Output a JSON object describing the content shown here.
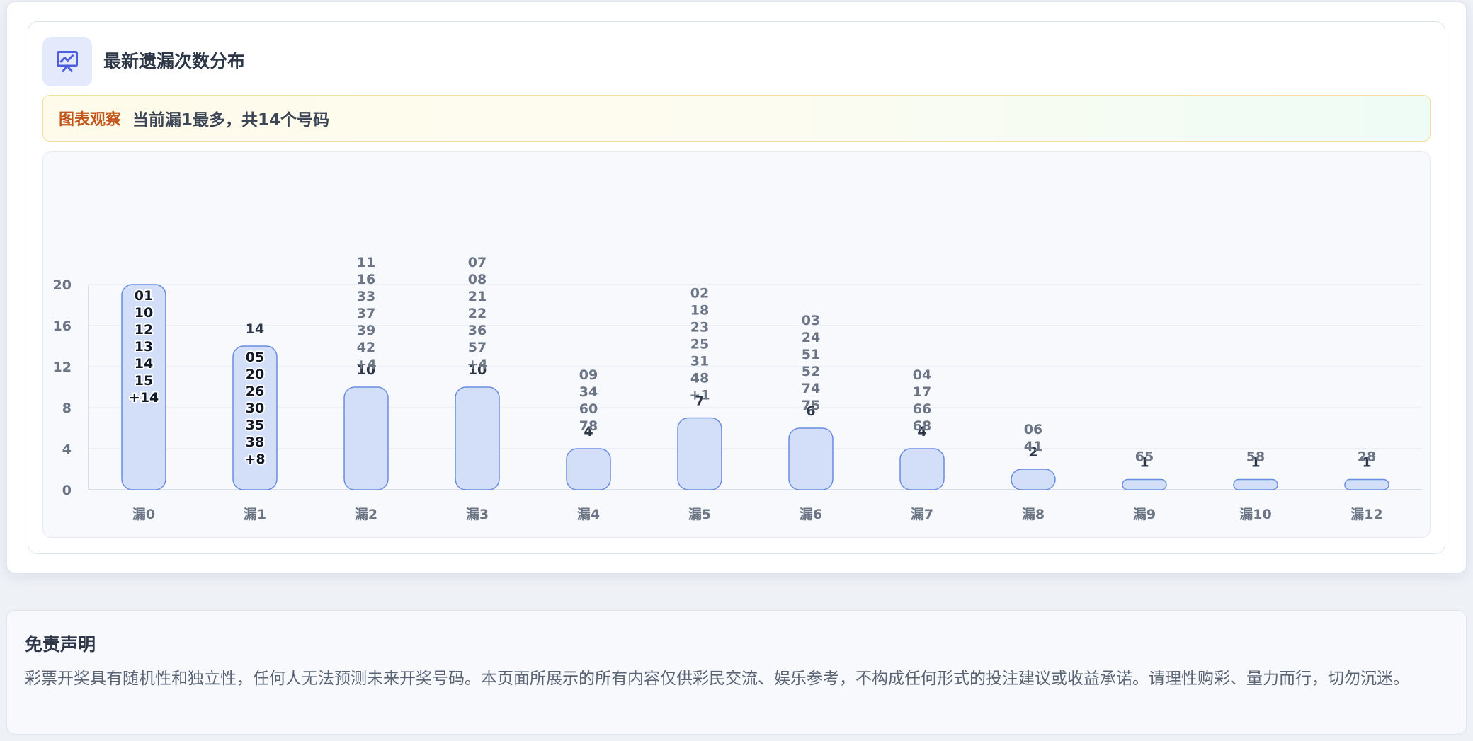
{
  "card": {
    "title": "最新遗漏次数分布",
    "icon": "presentation-chart-icon"
  },
  "insight": {
    "tag": "图表观察",
    "text": "当前漏1最多，共14个号码"
  },
  "colors": {
    "bar_fill": "#d3def8",
    "bar_stroke": "#6a8ce0",
    "accent": "#c0561b",
    "icon": "#4c5ee0"
  },
  "chart_data": {
    "type": "bar",
    "categories": [
      "漏0",
      "漏1",
      "漏2",
      "漏3",
      "漏4",
      "漏5",
      "漏6",
      "漏7",
      "漏8",
      "漏9",
      "漏10",
      "漏12"
    ],
    "values": [
      20,
      14,
      10,
      10,
      4,
      7,
      6,
      4,
      2,
      1,
      1,
      1
    ],
    "numbers": [
      [
        "01",
        "10",
        "12",
        "13",
        "14",
        "15",
        "+14"
      ],
      [
        "05",
        "20",
        "26",
        "30",
        "35",
        "38",
        "+8"
      ],
      [
        "11",
        "16",
        "33",
        "37",
        "39",
        "42",
        "+4"
      ],
      [
        "07",
        "08",
        "21",
        "22",
        "36",
        "57",
        "+4"
      ],
      [
        "09",
        "34",
        "60",
        "78"
      ],
      [
        "02",
        "18",
        "23",
        "25",
        "31",
        "48",
        "+1"
      ],
      [
        "03",
        "24",
        "51",
        "52",
        "74",
        "75"
      ],
      [
        "04",
        "17",
        "66",
        "68"
      ],
      [
        "06",
        "41"
      ],
      [
        "65"
      ],
      [
        "58"
      ],
      [
        "28"
      ]
    ],
    "y_ticks": [
      0,
      4,
      8,
      12,
      16,
      20
    ],
    "ylim": [
      0,
      20
    ],
    "grid": true
  },
  "disclaimer": {
    "title": "免责声明",
    "text": "彩票开奖具有随机性和独立性，任何人无法预测未来开奖号码。本页面所展示的所有内容仅供彩民交流、娱乐参考，不构成任何形式的投注建议或收益承诺。请理性购彩、量力而行，切勿沉迷。"
  }
}
